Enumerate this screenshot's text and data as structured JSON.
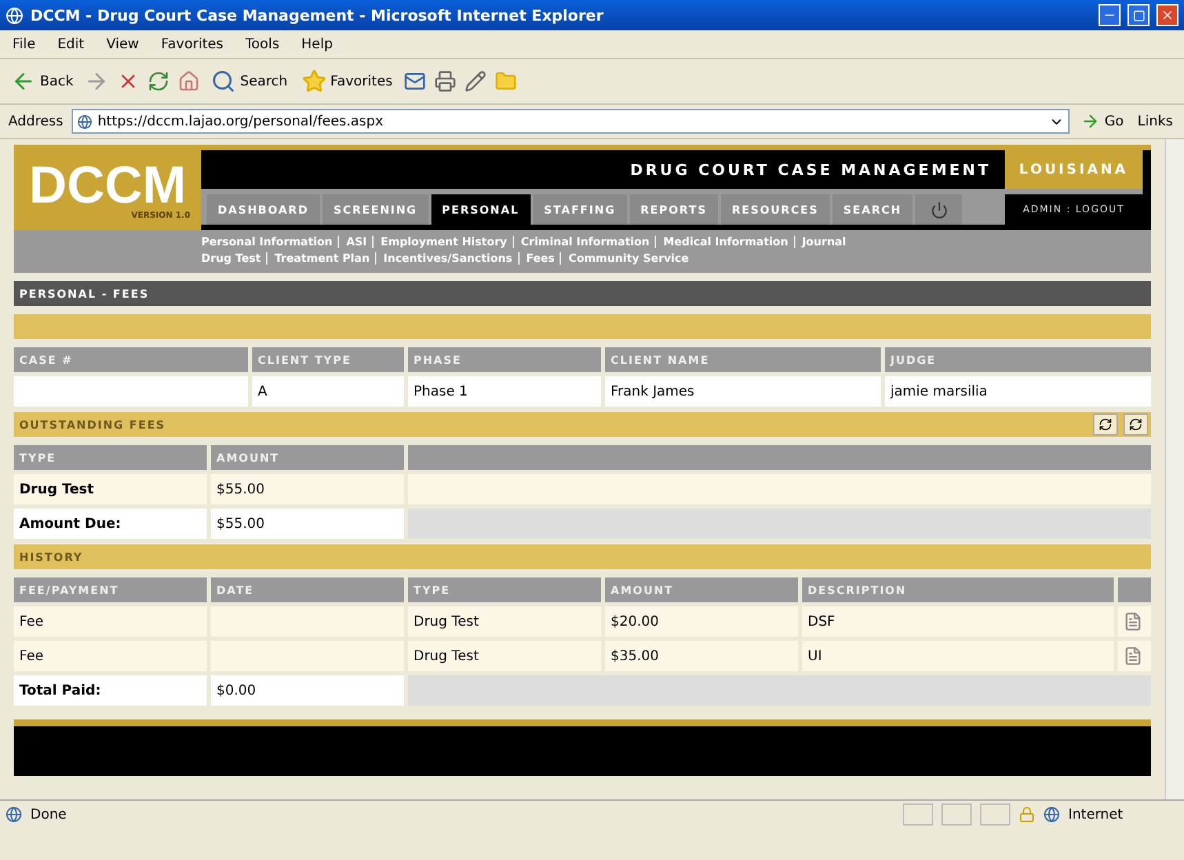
{
  "window": {
    "title": "DCCM - Drug Court Case Management - Microsoft Internet Explorer"
  },
  "menu": [
    "File",
    "Edit",
    "View",
    "Favorites",
    "Tools",
    "Help"
  ],
  "toolbar": {
    "back": "Back",
    "search": "Search",
    "favorites": "Favorites"
  },
  "address": {
    "label": "Address",
    "value": "https://dccm.lajao.org/personal/fees.aspx",
    "go": "Go",
    "links": "Links"
  },
  "app": {
    "logo": "DCCM",
    "version": "VERSION 1.0",
    "title": "DRUG COURT CASE MANAGEMENT",
    "state": "LOUISIANA",
    "user_links": "ADMIN : LOGOUT",
    "tabs": [
      {
        "label": "DASHBOARD",
        "selected": false
      },
      {
        "label": "SCREENING",
        "selected": false
      },
      {
        "label": "PERSONAL",
        "selected": true
      },
      {
        "label": "STAFFING",
        "selected": false
      },
      {
        "label": "REPORTS",
        "selected": false
      },
      {
        "label": "RESOURCES",
        "selected": false
      },
      {
        "label": "SEARCH",
        "selected": false
      }
    ],
    "subnav": [
      [
        "Personal Information",
        "ASI",
        "Employment History",
        "Criminal Information",
        "Medical Information",
        "Journal"
      ],
      [
        "Drug Test",
        "Treatment Plan",
        "Incentives/Sanctions",
        "Fees",
        "Community Service"
      ]
    ]
  },
  "page_title": "PERSONAL - FEES",
  "client": {
    "columns": [
      "CASE #",
      "CLIENT TYPE",
      "PHASE",
      "CLIENT NAME",
      "JUDGE"
    ],
    "row": {
      "client_type": "A",
      "phase": "Phase 1",
      "client_name": "Frank James",
      "judge": "jamie marsilia"
    }
  },
  "outstanding": {
    "title": "OUTSTANDING FEES",
    "columns": [
      "TYPE",
      "AMOUNT"
    ],
    "rows": [
      [
        "Drug Test",
        "$55.00"
      ]
    ],
    "total_label": "Amount Due:",
    "total": "$55.00"
  },
  "history": {
    "title": "HISTORY",
    "columns": [
      "FEE/PAYMENT",
      "DATE",
      "TYPE",
      "AMOUNT",
      "DESCRIPTION"
    ],
    "rows": [
      [
        "Fee",
        "",
        "Drug Test",
        "$20.00",
        "DSF"
      ],
      [
        "Fee",
        "",
        "Drug Test",
        "$35.00",
        "UI"
      ]
    ],
    "total_label": "Total Paid:",
    "total": "$0.00"
  },
  "status_bar": {
    "text": "Done",
    "zone": "Internet"
  }
}
